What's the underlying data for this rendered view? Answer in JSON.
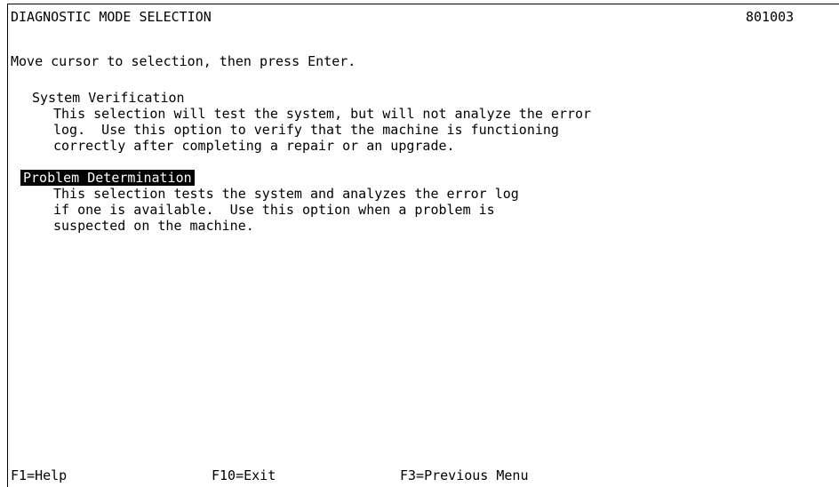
{
  "header": {
    "title": "DIAGNOSTIC MODE SELECTION",
    "code": "801003"
  },
  "instruction": "Move cursor to selection, then press Enter.",
  "options": [
    {
      "label": "System Verification",
      "selected": false,
      "description": "This selection will test the system, but will not analyze the error\nlog.  Use this option to verify that the machine is functioning\ncorrectly after completing a repair or an upgrade."
    },
    {
      "label": "Problem Determination",
      "selected": true,
      "description": "This selection tests the system and analyzes the error log\nif one is available.  Use this option when a problem is\nsuspected on the machine."
    }
  ],
  "function_keys": [
    {
      "label": "F1=Help"
    },
    {
      "label": "F10=Exit"
    },
    {
      "label": "F3=Previous Menu"
    }
  ]
}
